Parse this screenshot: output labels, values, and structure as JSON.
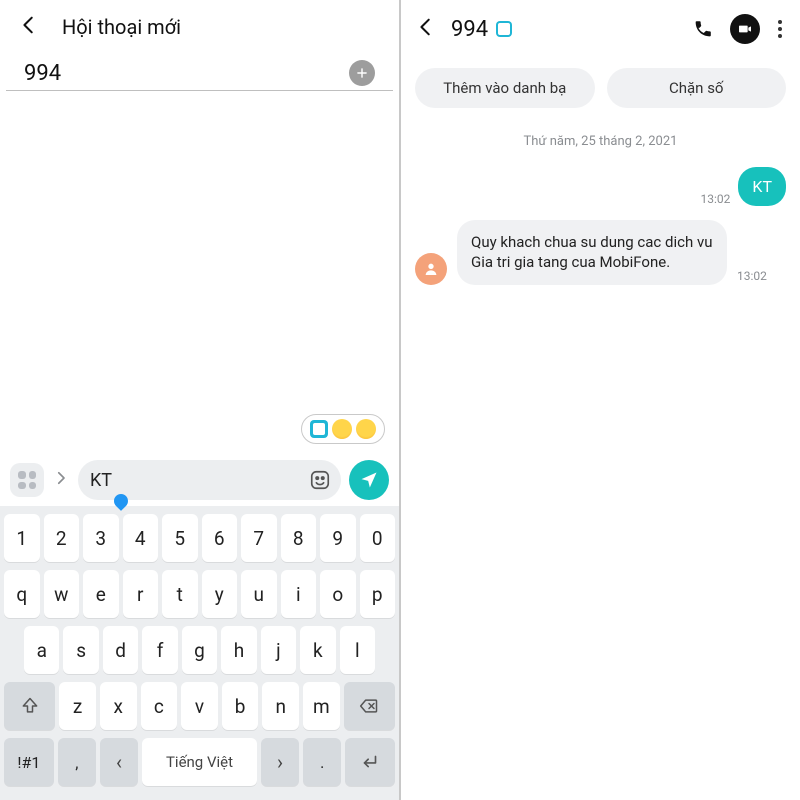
{
  "left": {
    "header_title": "Hội thoại mới",
    "recipient": "994",
    "compose_value": "KT",
    "keyboard": {
      "row1": [
        "1",
        "2",
        "3",
        "4",
        "5",
        "6",
        "7",
        "8",
        "9",
        "0"
      ],
      "row2": [
        "q",
        "w",
        "e",
        "r",
        "t",
        "y",
        "u",
        "i",
        "o",
        "p"
      ],
      "row3": [
        "a",
        "s",
        "d",
        "f",
        "g",
        "h",
        "j",
        "k",
        "l"
      ],
      "row4_mid": [
        "z",
        "x",
        "c",
        "v",
        "b",
        "n",
        "m"
      ],
      "sym_key": "!#1",
      "comma_key": ",",
      "space_label": "Tiếng Việt",
      "period_key": "."
    }
  },
  "right": {
    "title": "994",
    "chip_add": "Thêm vào danh bạ",
    "chip_block": "Chặn số",
    "date_sep": "Thứ năm, 25 tháng 2, 2021",
    "out_text": "KT",
    "out_time": "13:02",
    "in_text": "Quy khach chua su dung cac dich vu Gia tri gia tang cua MobiFone.",
    "in_time": "13:02"
  }
}
